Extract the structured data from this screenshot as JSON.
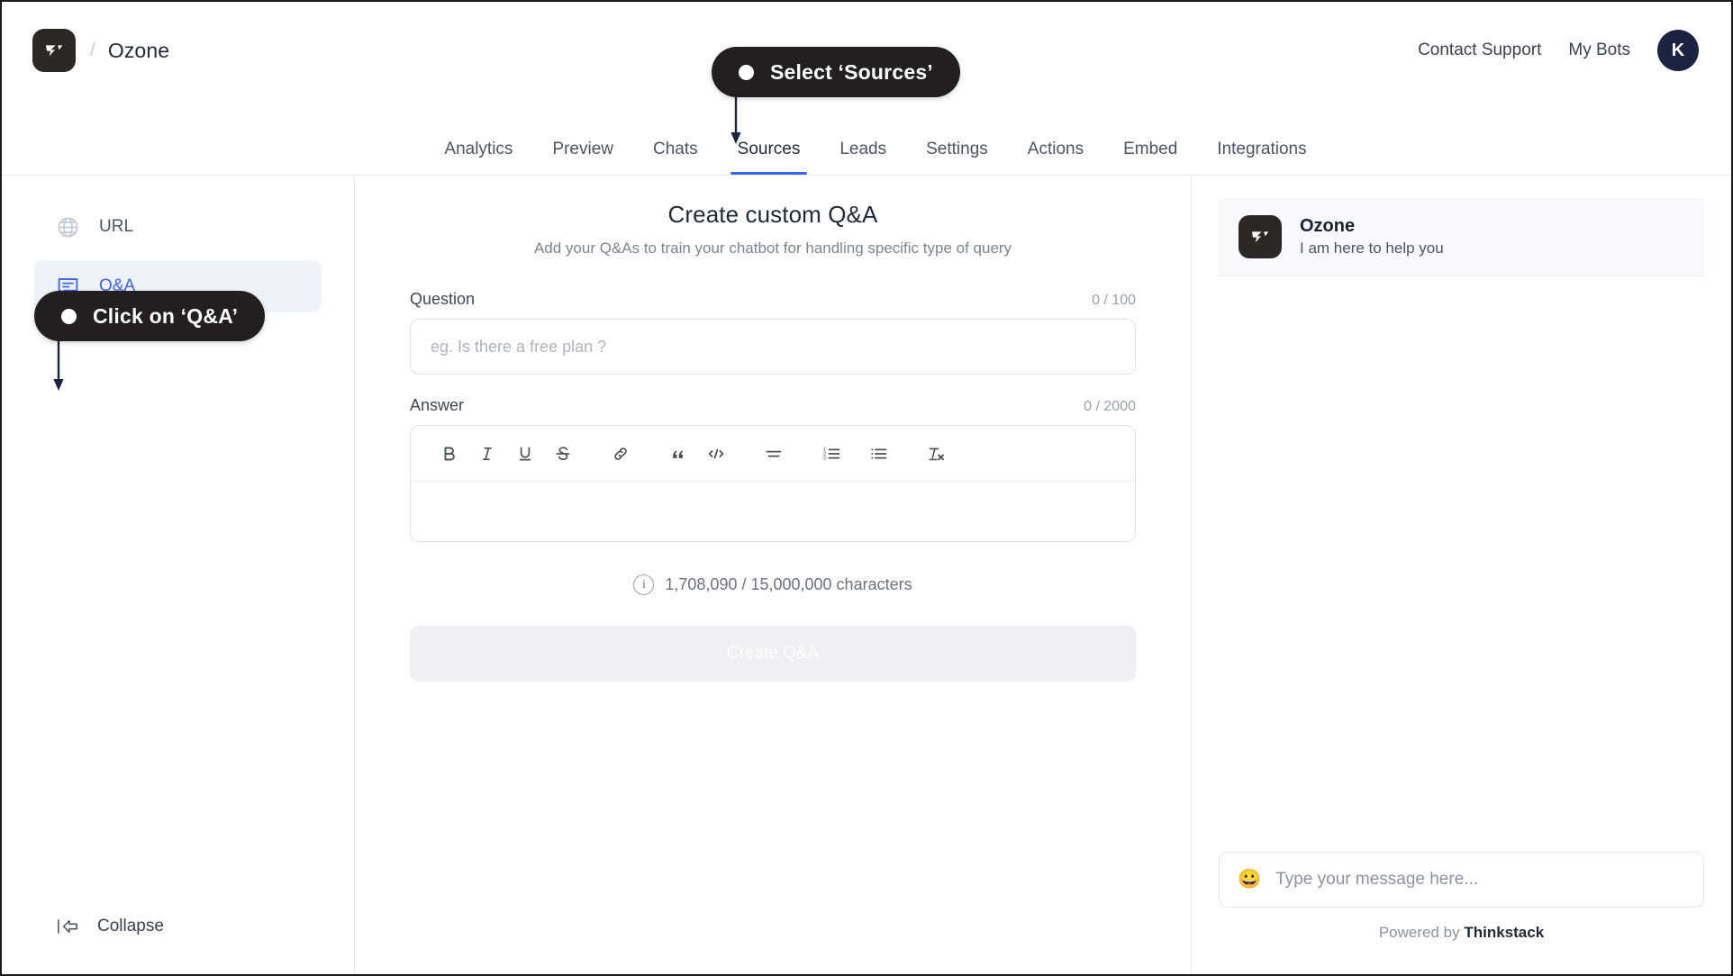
{
  "topbar": {
    "logo_icon": "thinkstack-logo-icon",
    "separator": "/",
    "bot_name": "Ozone",
    "contact_support": "Contact Support",
    "my_bots": "My Bots",
    "avatar_initial": "K"
  },
  "nav": {
    "tabs": [
      {
        "label": "Analytics",
        "active": false
      },
      {
        "label": "Preview",
        "active": false
      },
      {
        "label": "Chats",
        "active": false
      },
      {
        "label": "Sources",
        "active": true
      },
      {
        "label": "Leads",
        "active": false
      },
      {
        "label": "Settings",
        "active": false
      },
      {
        "label": "Actions",
        "active": false
      },
      {
        "label": "Embed",
        "active": false
      },
      {
        "label": "Integrations",
        "active": false
      }
    ],
    "active_color": "#3b63f6"
  },
  "sidebar": {
    "items": [
      {
        "label": "URL",
        "icon": "globe-icon",
        "active": false
      },
      {
        "label": "Q&A",
        "icon": "qa-chat-icon",
        "active": true
      }
    ],
    "collapse_label": "Collapse",
    "collapse_icon": "collapse-left-icon",
    "active_bg": "#eef2f9",
    "active_color": "#3b63f6"
  },
  "main": {
    "title": "Create custom Q&A",
    "subtitle": "Add your Q&As to train your chatbot for handling specific type of query",
    "question": {
      "label": "Question",
      "counter": "0 / 100",
      "placeholder": "eg. Is there a free plan ?",
      "value": ""
    },
    "answer": {
      "label": "Answer",
      "counter": "0 / 2000",
      "value": "",
      "toolbar": [
        {
          "name": "bold-icon",
          "glyph": "B"
        },
        {
          "name": "italic-icon",
          "glyph": "I"
        },
        {
          "name": "underline-icon",
          "glyph": "U"
        },
        {
          "name": "strikethrough-icon",
          "glyph": "S"
        },
        {
          "name": "link-icon",
          "glyph": "🔗"
        },
        {
          "name": "blockquote-icon",
          "glyph": "”"
        },
        {
          "name": "code-icon",
          "glyph": "</>"
        },
        {
          "name": "align-icon",
          "glyph": "≡"
        },
        {
          "name": "ordered-list-icon",
          "glyph": "1."
        },
        {
          "name": "bullet-list-icon",
          "glyph": "•"
        },
        {
          "name": "clear-format-icon",
          "glyph": "Tx"
        }
      ]
    },
    "char_usage": "1,708,090 / 15,000,000 characters",
    "info_icon": "info-icon",
    "submit_label": "Create Q&A",
    "submit_disabled": true
  },
  "preview": {
    "bot_name": "Ozone",
    "bot_status": "I am here to help you",
    "bot_avatar_icon": "thinkstack-logo-icon",
    "input_placeholder": "Type your message here...",
    "emoji_icon": "grinning-face-icon",
    "powered_prefix": "Powered by ",
    "powered_brand": "Thinkstack"
  },
  "callouts": [
    {
      "id": "sources",
      "text": "Select ‘Sources’"
    },
    {
      "id": "qna",
      "text": "Click on ‘Q&A’"
    }
  ],
  "colors": {
    "callout_bg": "#231f20",
    "accent": "#3b63f6",
    "logo_bg": "#2b2826",
    "avatar_bg": "#1b2341"
  }
}
